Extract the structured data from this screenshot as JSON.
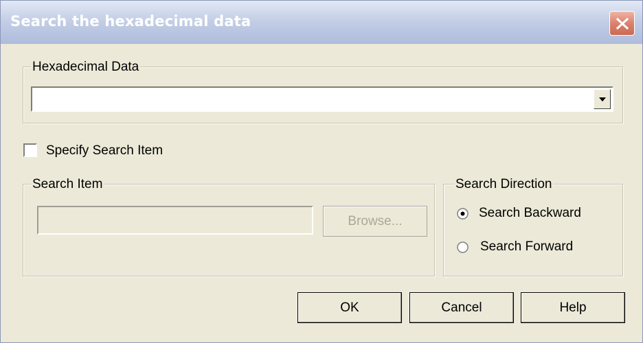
{
  "window": {
    "title": "Search the hexadecimal data",
    "close_icon": "close-icon"
  },
  "hex_group": {
    "legend": "Hexadecimal Data",
    "combo_value": "",
    "dropdown_icon": "chevron-down-icon"
  },
  "specify": {
    "label": "Specify Search Item",
    "checked": false
  },
  "search_item_group": {
    "legend": "Search Item",
    "input_value": "",
    "browse_label": "Browse...",
    "disabled": true
  },
  "direction_group": {
    "legend": "Search Direction",
    "options": [
      {
        "label": "Search Backward",
        "selected": true
      },
      {
        "label": "Search Forward",
        "selected": false
      }
    ]
  },
  "buttons": {
    "ok": "OK",
    "cancel": "Cancel",
    "help": "Help"
  },
  "colors": {
    "face": "#ece9d8",
    "title_text": "#ffffff",
    "close_button": "#d9826e",
    "disabled_text": "#aca899"
  }
}
